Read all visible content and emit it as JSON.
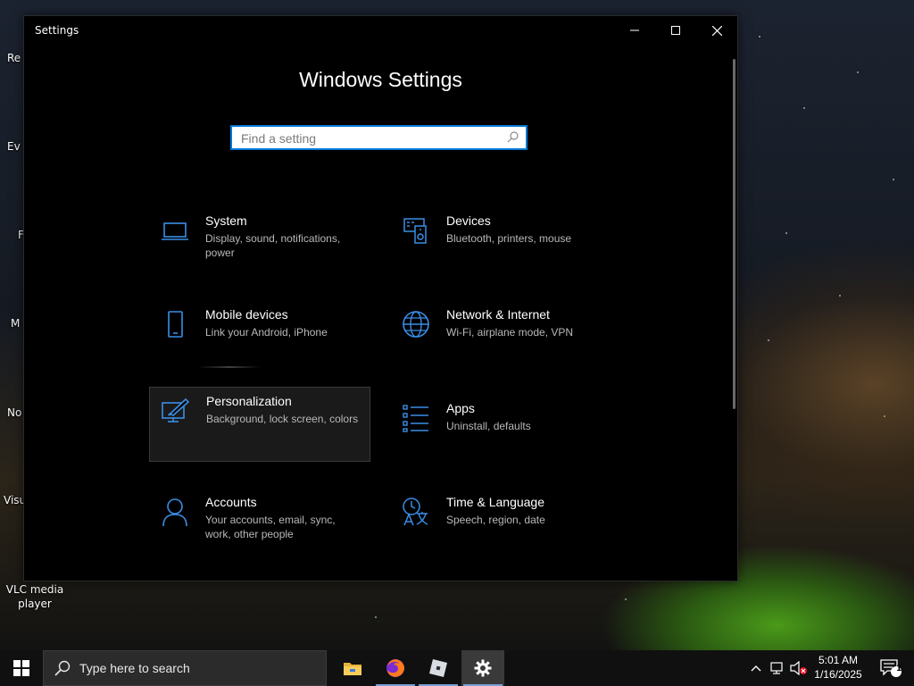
{
  "window": {
    "title": "Settings",
    "heading": "Windows Settings",
    "search_placeholder": "Find a setting"
  },
  "tiles": [
    {
      "name": "System",
      "description": "Display, sound, notifications, power",
      "icon": "laptop-icon"
    },
    {
      "name": "Devices",
      "description": "Bluetooth, printers, mouse",
      "icon": "devices-icon"
    },
    {
      "name": "Mobile devices",
      "description": "Link your Android, iPhone",
      "icon": "phone-icon"
    },
    {
      "name": "Network & Internet",
      "description": "Wi-Fi, airplane mode, VPN",
      "icon": "globe-icon"
    },
    {
      "name": "Personalization",
      "description": "Background, lock screen, colors",
      "icon": "paint-icon"
    },
    {
      "name": "Apps",
      "description": "Uninstall, defaults",
      "icon": "apps-list-icon"
    },
    {
      "name": "Accounts",
      "description": "Your accounts, email, sync, work, other people",
      "icon": "person-icon"
    },
    {
      "name": "Time & Language",
      "description": "Speech, region, date",
      "icon": "time-language-icon"
    }
  ],
  "desktop": {
    "icons_partial": [
      "Re",
      "Ev",
      "F",
      "M",
      "No",
      "Visu"
    ],
    "vlc_label": "VLC media player"
  },
  "taskbar": {
    "search_placeholder": "Type here to search",
    "time": "5:01 AM",
    "date": "1/16/2025",
    "notification_count": "1"
  },
  "colors": {
    "accent": "#0078d7",
    "icon_blue": "#3a8ee6"
  }
}
